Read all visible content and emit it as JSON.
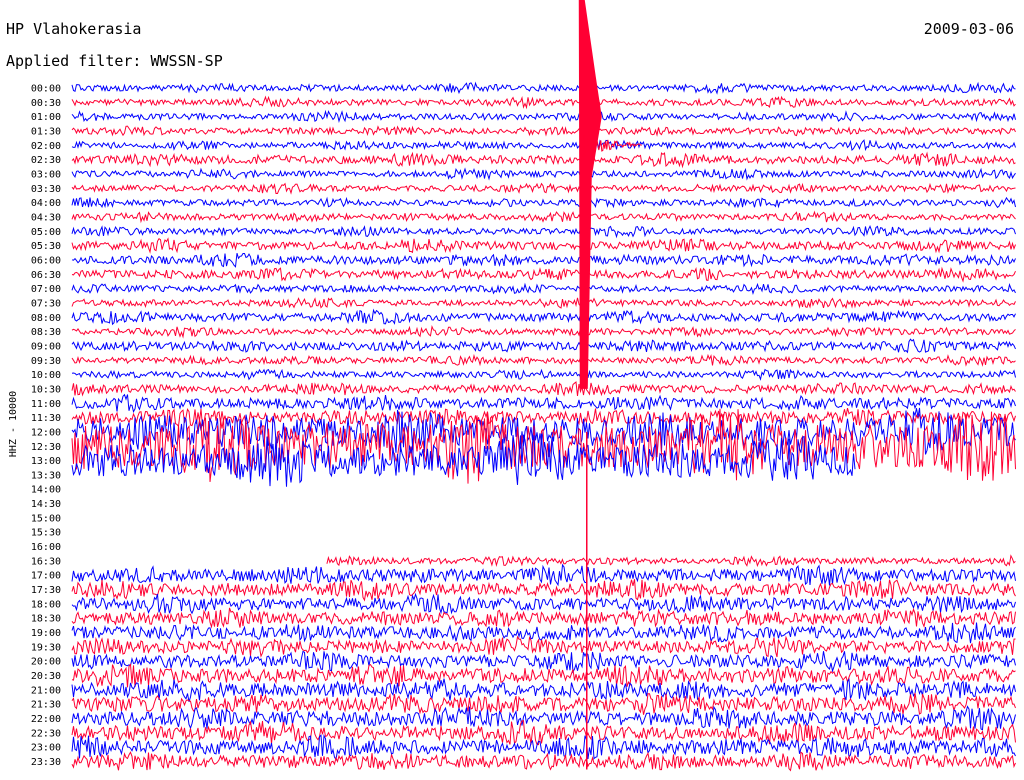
{
  "header": {
    "station": "HP Vlahokerasia",
    "date": "2009-03-06",
    "filter": "Applied filter: WWSSN-SP"
  },
  "chart_data": {
    "type": "line",
    "title": "HP Vlahokerasia",
    "subtitle": "Applied filter: WWSSN-SP",
    "date": "2009-03-06",
    "ylabel": "HHZ - 10000",
    "xlabel": "",
    "grid": false,
    "legend": "none",
    "colors": {
      "even": "#0000ff",
      "odd": "#ff0033"
    },
    "y_ticks": [
      "00:00",
      "00:30",
      "01:00",
      "01:30",
      "02:00",
      "02:30",
      "03:00",
      "03:30",
      "04:00",
      "04:30",
      "05:00",
      "05:30",
      "06:00",
      "06:30",
      "07:00",
      "07:30",
      "08:00",
      "08:30",
      "09:00",
      "09:30",
      "10:00",
      "10:30",
      "11:00",
      "11:30",
      "12:00",
      "12:30",
      "13:00",
      "13:30",
      "14:00",
      "14:30",
      "15:00",
      "15:30",
      "16:00",
      "16:30",
      "17:00",
      "17:30",
      "18:00",
      "18:30",
      "19:00",
      "19:30",
      "20:00",
      "20:30",
      "21:00",
      "21:30",
      "22:00",
      "22:30",
      "23:00",
      "23:30"
    ],
    "rows_amplitude": [
      3,
      3,
      3,
      3,
      3,
      4,
      3,
      3,
      3,
      3,
      3,
      4,
      4,
      4,
      3,
      3,
      4,
      3,
      4,
      3,
      3,
      4,
      5,
      6,
      14,
      22,
      16,
      0,
      0,
      0,
      0,
      0,
      0,
      3,
      6,
      6,
      6,
      6,
      6,
      6,
      6,
      7,
      7,
      7,
      7,
      7,
      7,
      6
    ],
    "row_data_start_fraction": [
      0,
      0,
      0,
      0,
      0,
      0,
      0,
      0,
      0,
      0,
      0,
      0,
      0,
      0,
      0,
      0,
      0,
      0,
      0,
      0,
      0,
      0,
      0,
      0,
      0,
      0,
      0,
      1,
      1,
      1,
      1,
      1,
      1,
      0.27,
      0,
      0,
      0,
      0,
      0,
      0,
      0,
      0,
      0,
      0,
      0,
      0,
      0,
      0
    ],
    "row_data_end_fraction": [
      1,
      1,
      1,
      1,
      1,
      1,
      1,
      1,
      1,
      1,
      1,
      1,
      1,
      1,
      1,
      1,
      1,
      1,
      1,
      1,
      1,
      1,
      1,
      1,
      1,
      1,
      0.83,
      0,
      0,
      0,
      0,
      0,
      0,
      1,
      1,
      1,
      1,
      1,
      1,
      1,
      1,
      1,
      1,
      1,
      1,
      1,
      1,
      1
    ],
    "event": {
      "row": "01:00",
      "x_fraction": 0.54,
      "peak_rows_span": 21
    }
  }
}
